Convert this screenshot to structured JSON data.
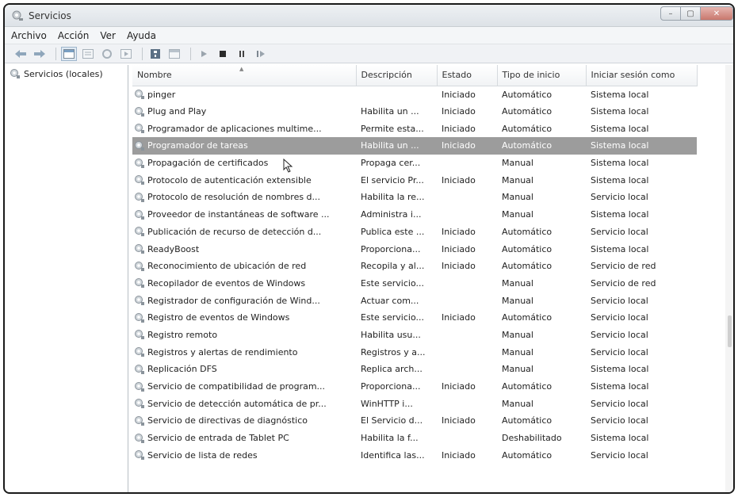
{
  "window": {
    "title": "Servicios",
    "controls": [
      "–",
      "▢",
      "✕"
    ]
  },
  "menu": [
    "Archivo",
    "Acción",
    "Ver",
    "Ayuda"
  ],
  "tree": {
    "item": "Servicios (locales)"
  },
  "table": {
    "headers": [
      "Nombre",
      "Descripción",
      "Estado",
      "Tipo de inicio",
      "Iniciar sesión como"
    ],
    "selected_index": 3,
    "rows": [
      [
        "pinger",
        "",
        "Iniciado",
        "Automático",
        "Sistema local"
      ],
      [
        "Plug and Play",
        "Habilita un ...",
        "Iniciado",
        "Automático",
        "Sistema local"
      ],
      [
        "Programador de aplicaciones multime...",
        "Permite esta...",
        "Iniciado",
        "Automático",
        "Sistema local"
      ],
      [
        "Programador de tareas",
        "Habilita un ...",
        "Iniciado",
        "Automático",
        "Sistema local"
      ],
      [
        "Propagación de certificados",
        "Propaga cer...",
        "",
        "Manual",
        "Sistema local"
      ],
      [
        "Protocolo de autenticación extensible",
        "El servicio Pr...",
        "Iniciado",
        "Manual",
        "Sistema local"
      ],
      [
        "Protocolo de resolución de nombres d...",
        "Habilita la re...",
        "",
        "Manual",
        "Servicio local"
      ],
      [
        "Proveedor de instantáneas de software ...",
        "Administra i...",
        "",
        "Manual",
        "Sistema local"
      ],
      [
        "Publicación de recurso de detección d...",
        "Publica este ...",
        "Iniciado",
        "Automático",
        "Servicio local"
      ],
      [
        "ReadyBoost",
        "Proporciona...",
        "Iniciado",
        "Automático",
        "Sistema local"
      ],
      [
        "Reconocimiento de ubicación de red",
        "Recopila y al...",
        "Iniciado",
        "Automático",
        "Servicio de red"
      ],
      [
        "Recopilador de eventos de Windows",
        "Este servicio...",
        "",
        "Manual",
        "Servicio de red"
      ],
      [
        "Registrador de configuración de Wind...",
        "Actuar com...",
        "",
        "Manual",
        "Servicio local"
      ],
      [
        "Registro de eventos de Windows",
        "Este servicio...",
        "Iniciado",
        "Automático",
        "Servicio local"
      ],
      [
        "Registro remoto",
        "Habilita usu...",
        "",
        "Manual",
        "Servicio local"
      ],
      [
        "Registros y alertas de rendimiento",
        "Registros y a...",
        "",
        "Manual",
        "Servicio local"
      ],
      [
        "Replicación DFS",
        "Replica arch...",
        "",
        "Manual",
        "Sistema local"
      ],
      [
        "Servicio de compatibilidad de program...",
        "Proporciona...",
        "Iniciado",
        "Automático",
        "Sistema local"
      ],
      [
        "Servicio de detección automática de pr...",
        "WinHTTP i...",
        "",
        "Manual",
        "Servicio local"
      ],
      [
        "Servicio de directivas de diagnóstico",
        "El Servicio d...",
        "Iniciado",
        "Automático",
        "Servicio local"
      ],
      [
        "Servicio de entrada de Tablet PC",
        "Habilita la f...",
        "",
        "Deshabilitado",
        "Sistema local"
      ],
      [
        "Servicio de lista de redes",
        "Identifica las...",
        "Iniciado",
        "Automático",
        "Servicio local"
      ]
    ]
  },
  "colors": {
    "selection": "#9c9c9c",
    "frame": "#1a1a1a",
    "titlebar": "#e6eaee"
  },
  "icons": {
    "service": "gear-magnifier-icon",
    "back": "back-arrow-icon",
    "forward": "forward-arrow-icon",
    "play": "play-icon",
    "stop": "stop-icon",
    "pause": "pause-icon",
    "restart": "restart-icon"
  }
}
